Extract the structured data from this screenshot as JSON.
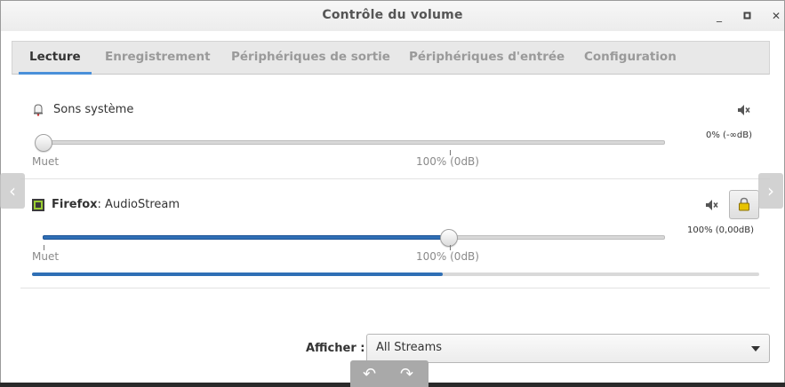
{
  "window": {
    "title": "Contrôle du volume",
    "controls": {
      "minimize": "_",
      "maximize": "▫",
      "close": "✕"
    }
  },
  "tabs": [
    {
      "label": "Lecture",
      "active": true
    },
    {
      "label": "Enregistrement",
      "active": false
    },
    {
      "label": "Périphériques de sortie",
      "active": false
    },
    {
      "label": "Périphériques d'entrée",
      "active": false
    },
    {
      "label": "Configuration",
      "active": false
    }
  ],
  "streams": [
    {
      "icon": "bell-icon",
      "name": "Sons système",
      "app_bold": "",
      "volume_text": "0% (-∞dB)",
      "volume_percent": 0,
      "min_label": "Muet",
      "mid_label": "100% (0dB)",
      "mute_icon": "speaker-mute-icon"
    },
    {
      "icon": "application-icon",
      "app_bold": "Firefox",
      "name": ": AudioStream",
      "volume_text": "100% (0,00dB)",
      "volume_percent": 100,
      "peak_level_fraction": 0.565,
      "min_label": "Muet",
      "mid_label": "100% (0dB)",
      "mute_icon": "speaker-mute-icon",
      "lock_icon": "padlock-icon"
    }
  ],
  "footer": {
    "filter_label": "Afficher :",
    "filter_value": "All Streams",
    "osd_undo": "↶",
    "osd_redo": "↷"
  },
  "colors": {
    "accent": "#4a90d9",
    "slider_fill": "#2f6fb5"
  }
}
